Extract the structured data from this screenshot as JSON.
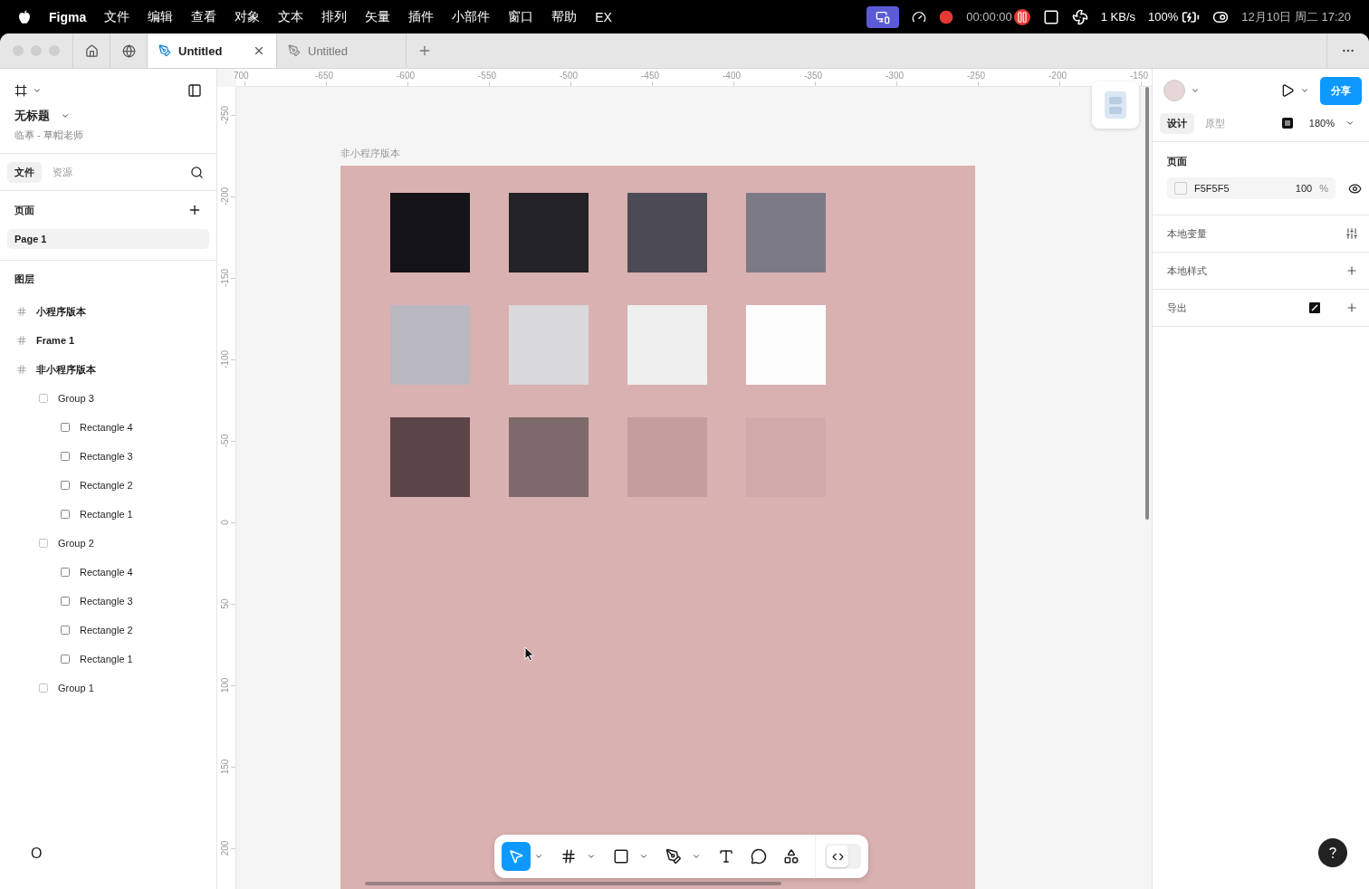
{
  "menubar": {
    "app": "Figma",
    "menus": [
      "文件",
      "编辑",
      "查看",
      "对象",
      "文本",
      "排列",
      "矢量",
      "插件",
      "小部件",
      "窗口",
      "帮助",
      "EX"
    ],
    "timer": "00:00:00",
    "network": "1 KB/s",
    "battery": "100%",
    "datetime": "12月10日 周二 17:20"
  },
  "tabs": [
    {
      "label": "Untitled",
      "selected": true
    },
    {
      "label": "Untitled",
      "selected": false
    }
  ],
  "left_panel": {
    "file_name": "无标题",
    "subtitle": "临摹 - 草帽老师",
    "tabs": [
      {
        "label": "文件",
        "selected": true
      },
      {
        "label": "资源",
        "selected": false
      }
    ],
    "pages_heading": "页面",
    "pages": [
      {
        "label": "Page 1",
        "selected": true
      }
    ],
    "layers_heading": "图层",
    "layers": [
      {
        "kind": "frame",
        "label": "小程序版本"
      },
      {
        "kind": "frame",
        "label": "Frame 1"
      },
      {
        "kind": "frame",
        "label": "非小程序版本",
        "children": [
          {
            "kind": "group",
            "label": "Group 3",
            "children": [
              {
                "kind": "rectangle",
                "label": "Rectangle 4"
              },
              {
                "kind": "rectangle",
                "label": "Rectangle 3"
              },
              {
                "kind": "rectangle",
                "label": "Rectangle 2"
              },
              {
                "kind": "rectangle",
                "label": "Rectangle 1"
              }
            ]
          },
          {
            "kind": "group",
            "label": "Group 2",
            "children": [
              {
                "kind": "rectangle",
                "label": "Rectangle 4"
              },
              {
                "kind": "rectangle",
                "label": "Rectangle 3"
              },
              {
                "kind": "rectangle",
                "label": "Rectangle 2"
              },
              {
                "kind": "rectangle",
                "label": "Rectangle 1"
              }
            ]
          },
          {
            "kind": "group",
            "label": "Group 1"
          }
        ]
      }
    ],
    "footer": "O"
  },
  "canvas": {
    "top_ruler": [
      "700",
      "-650",
      "-600",
      "-550",
      "-500",
      "-450",
      "-400",
      "-350",
      "-300",
      "-250",
      "-200",
      "-150"
    ],
    "left_ruler": [
      "-250",
      "-200",
      "-150",
      "-100",
      "-50",
      "0",
      "50",
      "100",
      "150",
      "200"
    ],
    "frame_label": "非小程序版本",
    "swatches": [
      {
        "color": "#141318"
      },
      {
        "color": "#232226"
      },
      {
        "color": "#4c4a55"
      },
      {
        "color": "#7d7a88"
      },
      {
        "color": "#b9b7c0"
      },
      {
        "color": "#d9d9dc"
      },
      {
        "color": "#efefef"
      },
      {
        "color": "#fdfdfd"
      },
      {
        "color": "#5c4548"
      },
      {
        "color": "#7f6a6b"
      },
      {
        "color": "#c49d9e"
      },
      {
        "color": "#d2a9aa"
      }
    ],
    "tools": [
      {
        "kind": "move",
        "selected": true,
        "menu": true
      },
      {
        "kind": "frame",
        "selected": false,
        "menu": true
      },
      {
        "kind": "shape",
        "selected": false,
        "menu": true
      },
      {
        "kind": "pen",
        "selected": false,
        "menu": true
      },
      {
        "kind": "text",
        "selected": false,
        "menu": false
      },
      {
        "kind": "comment",
        "selected": false,
        "menu": false
      },
      {
        "kind": "actions",
        "selected": false,
        "menu": false
      }
    ],
    "dev_mode": false
  },
  "right_panel": {
    "share": "分享",
    "tabs": [
      {
        "label": "设计",
        "selected": true
      },
      {
        "label": "原型",
        "selected": false
      }
    ],
    "zoom": "180%",
    "page_heading": "页面",
    "page_color": "F5F5F5",
    "opacity": "100",
    "percent": "%",
    "sections": [
      {
        "kind": "variables",
        "label": "本地变量"
      },
      {
        "kind": "styles",
        "label": "本地样式"
      },
      {
        "kind": "export",
        "label": "导出"
      }
    ]
  }
}
